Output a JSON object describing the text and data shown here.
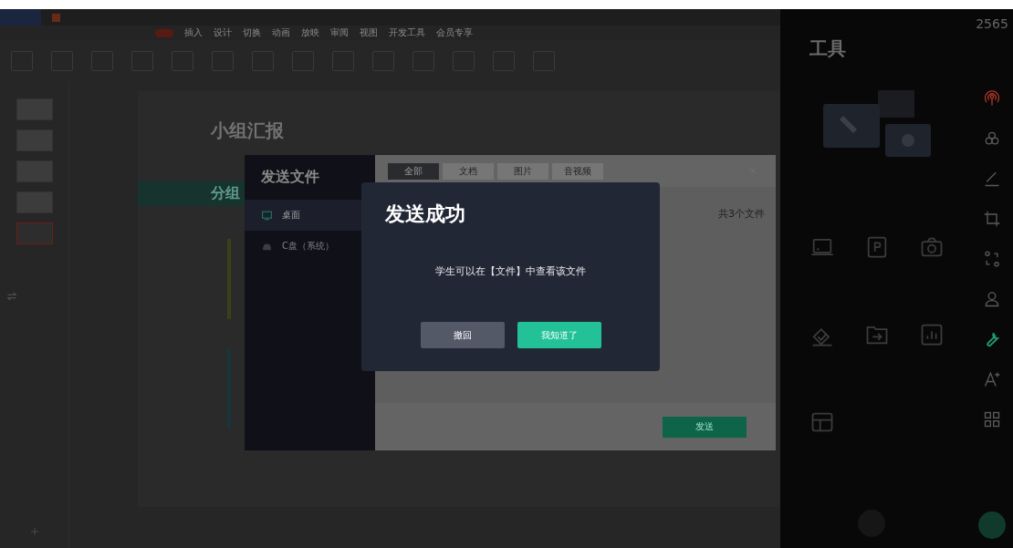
{
  "ribbon": {
    "tabs": [
      {
        "label": "插入",
        "selected": false
      },
      {
        "label": "设计",
        "selected": false
      },
      {
        "label": "切换",
        "selected": false
      },
      {
        "label": "动画",
        "selected": false
      },
      {
        "label": "放映",
        "selected": false
      },
      {
        "label": "审阅",
        "selected": false
      },
      {
        "label": "视图",
        "selected": false
      },
      {
        "label": "开发工具",
        "selected": false
      },
      {
        "label": "会员专享",
        "selected": false
      }
    ]
  },
  "thumbnails": [
    {
      "selected": false
    },
    {
      "selected": false
    },
    {
      "selected": false
    },
    {
      "selected": false
    },
    {
      "selected": true
    }
  ],
  "slide": {
    "title": "小组汇报",
    "banner": "分组"
  },
  "send_dialog": {
    "title": "发送文件",
    "locations": [
      {
        "label": "桌面",
        "kind": "desktop",
        "selected": true
      },
      {
        "label": "C盘（系统）",
        "kind": "drive",
        "selected": false
      }
    ],
    "tabs": [
      {
        "label": "全部",
        "selected": true
      },
      {
        "label": "文档",
        "selected": false
      },
      {
        "label": "图片",
        "selected": false
      },
      {
        "label": "音视频",
        "selected": false
      }
    ],
    "file_count": "共3个文件",
    "send_button": "发送"
  },
  "success_modal": {
    "title": "发送成功",
    "message": "学生可以在【文件】中查看该文件",
    "buttons": [
      {
        "label": "撤回",
        "kind": "secondary"
      },
      {
        "label": "我知道了",
        "kind": "primary"
      }
    ]
  },
  "tools_panel": {
    "title": "工具",
    "tools": [
      {
        "kind": "laptop"
      },
      {
        "kind": "slides"
      },
      {
        "kind": "camera"
      },
      {
        "kind": "check"
      },
      {
        "kind": "folder"
      },
      {
        "kind": "chart"
      },
      {
        "kind": "layout"
      }
    ]
  },
  "sidebar": {
    "counter": "2565",
    "items": [
      {
        "kind": "broadcast",
        "active": true,
        "selected": false
      },
      {
        "kind": "circles",
        "active": false,
        "selected": false
      },
      {
        "kind": "pen",
        "active": false,
        "selected": false
      },
      {
        "kind": "crop",
        "active": false,
        "selected": false
      },
      {
        "kind": "nodes",
        "active": false,
        "selected": false
      },
      {
        "kind": "person",
        "active": false,
        "selected": false
      },
      {
        "kind": "wrench",
        "active": false,
        "selected": true
      },
      {
        "kind": "font",
        "active": false,
        "selected": false
      },
      {
        "kind": "grid",
        "active": false,
        "selected": false
      }
    ]
  }
}
